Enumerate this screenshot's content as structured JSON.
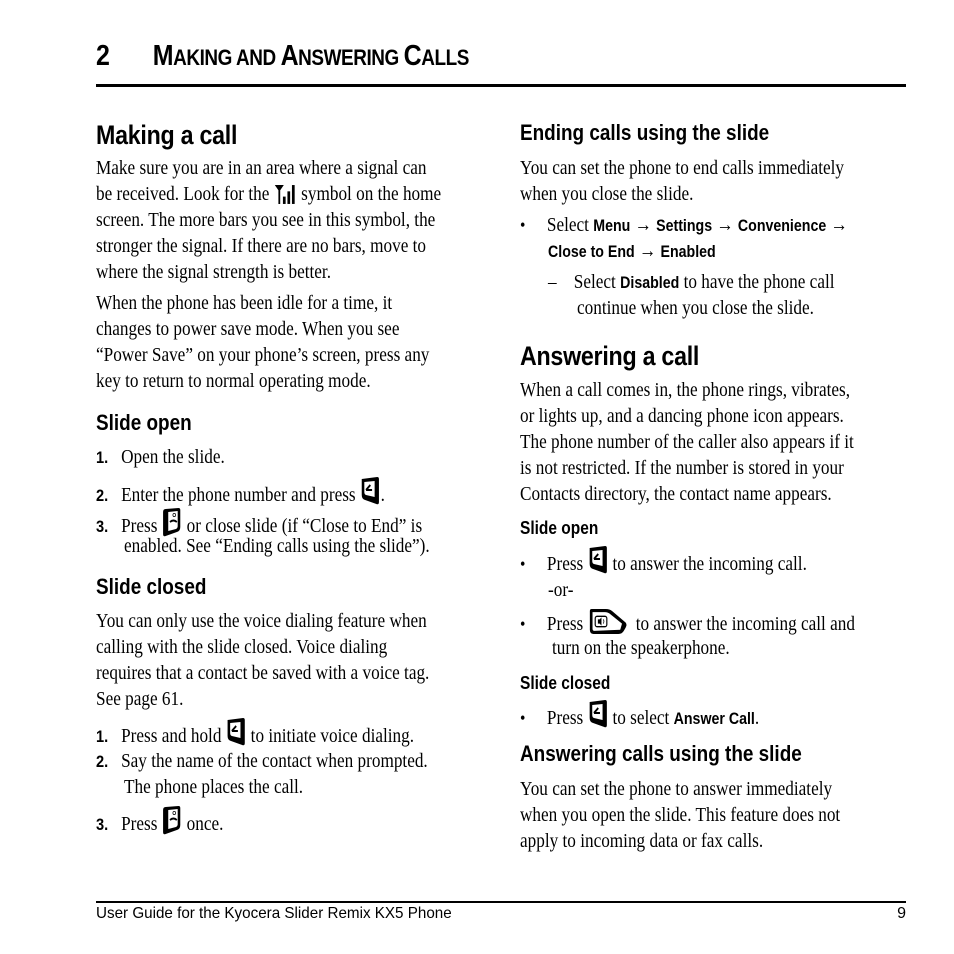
{
  "header": {
    "chapter_number": "2",
    "chapter_title_parts": [
      "M",
      "AKING AND ",
      "A",
      "NSWERING ",
      "C",
      "ALLS"
    ]
  },
  "left": {
    "making_a_call": {
      "heading": "Making a call",
      "para1_lines": [
        "Make sure you are in an area where a signal can",
        "be received. Look for the",
        "symbol on the home",
        "screen. The more bars you see in this symbol, the",
        "stronger the signal. If there are no bars, move to",
        "where the signal strength is better."
      ],
      "para2_lines": [
        "When the phone has been idle for a time, it",
        "changes to power save mode. When you see",
        "“Power Save” on your phone’s screen, press any",
        "key to return to normal operating mode."
      ]
    },
    "slide_open": {
      "heading": "Slide open",
      "steps": [
        {
          "num": "1.",
          "text": "Open the slide."
        },
        {
          "num": "2.",
          "text_before": "Enter the phone number and press",
          "icon": "send-key-icon",
          "text_after": "."
        },
        {
          "num": "3.",
          "text_before": "Press",
          "icon": "end-key-icon",
          "text_after": "or close slide (if “Close to End” is",
          "text_line2": "enabled. See “Ending calls using the slide”)."
        }
      ]
    },
    "slide_closed": {
      "heading": "Slide closed",
      "para_lines": [
        "You can only use the voice dialing feature when",
        "calling with the slide closed. Voice dialing",
        "requires that a contact be saved with a voice tag.",
        "See page 61."
      ],
      "steps": [
        {
          "num": "1.",
          "text_before": "Press and hold",
          "icon": "send-key-icon",
          "text_after": "to initiate voice dialing."
        },
        {
          "num": "2.",
          "text": "Say the name of the contact when prompted.",
          "text_line2": "The phone places the call."
        },
        {
          "num": "3.",
          "text_before": "Press",
          "icon": "end-key-icon",
          "text_after": "once."
        }
      ]
    }
  },
  "right": {
    "ending_calls": {
      "heading": "Ending calls using the slide",
      "para_lines": [
        "You can set the phone to end calls immediately",
        "when you close the slide."
      ],
      "bullet": {
        "prefix": "Select",
        "path": [
          "Menu",
          "Settings",
          "Convenience",
          "Close to End",
          "Enabled"
        ],
        "arrow": "→"
      },
      "sub_bullet": {
        "prefix": "Select",
        "bold": "Disabled",
        "rest": "to have the phone call",
        "line2": "continue when you close the slide."
      }
    },
    "answering": {
      "heading": "Answering a call",
      "para_lines": [
        "When a call comes in, the phone rings, vibrates,",
        "or lights up, and a dancing phone icon appears.",
        "The phone number of the caller also appears if it",
        "is not restricted. If the number is stored in your",
        "Contacts directory, the contact name appears."
      ],
      "slide_open": {
        "heading": "Slide open",
        "bullet1": {
          "before": "Press",
          "icon": "send-key-icon",
          "after": "to answer the incoming call."
        },
        "or_text": "-or-",
        "bullet2": {
          "before": "Press",
          "icon": "speakerphone-key-icon",
          "after": "to answer the incoming call and",
          "line2": "turn on the speakerphone."
        }
      },
      "slide_closed": {
        "heading": "Slide closed",
        "bullet": {
          "before": "Press",
          "icon": "send-key-icon",
          "after": "to select",
          "bold": "Answer Call",
          "end": "."
        }
      }
    },
    "answering_slide": {
      "heading": "Answering calls using the slide",
      "para_lines": [
        "You can set the phone to answer immediately",
        "when you open the slide. This feature does not",
        "apply to incoming data or fax calls."
      ]
    }
  },
  "footer": {
    "title": "User Guide for the Kyocera Slider Remix KX5 Phone",
    "page_number": "9"
  },
  "bullet_char": "•",
  "dash_char": "–"
}
